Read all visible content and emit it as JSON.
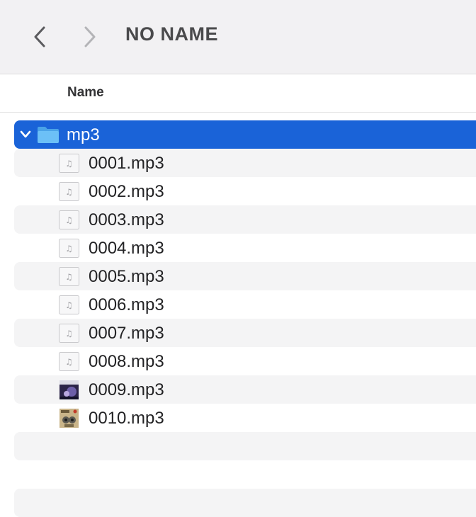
{
  "window": {
    "title": "NO NAME"
  },
  "toolbar": {
    "back_icon": "chevron-left-icon",
    "forward_icon": "chevron-right-icon"
  },
  "list": {
    "column_header": "Name",
    "folder": {
      "name": "mp3",
      "expanded": true,
      "selected": true,
      "icon": "folder-icon"
    },
    "files": [
      {
        "name": "0001.mp3",
        "icon": "audio-file-icon"
      },
      {
        "name": "0002.mp3",
        "icon": "audio-file-icon"
      },
      {
        "name": "0003.mp3",
        "icon": "audio-file-icon"
      },
      {
        "name": "0004.mp3",
        "icon": "audio-file-icon"
      },
      {
        "name": "0005.mp3",
        "icon": "audio-file-icon"
      },
      {
        "name": "0006.mp3",
        "icon": "audio-file-icon"
      },
      {
        "name": "0007.mp3",
        "icon": "audio-file-icon"
      },
      {
        "name": "0008.mp3",
        "icon": "audio-file-icon"
      },
      {
        "name": "0009.mp3",
        "icon": "album-art-thumbnail"
      },
      {
        "name": "0010.mp3",
        "icon": "album-art-thumbnail"
      }
    ]
  },
  "colors": {
    "selection": "#1a63d8",
    "folder": "#5fb4f2",
    "stripe": "#f4f4f5"
  }
}
